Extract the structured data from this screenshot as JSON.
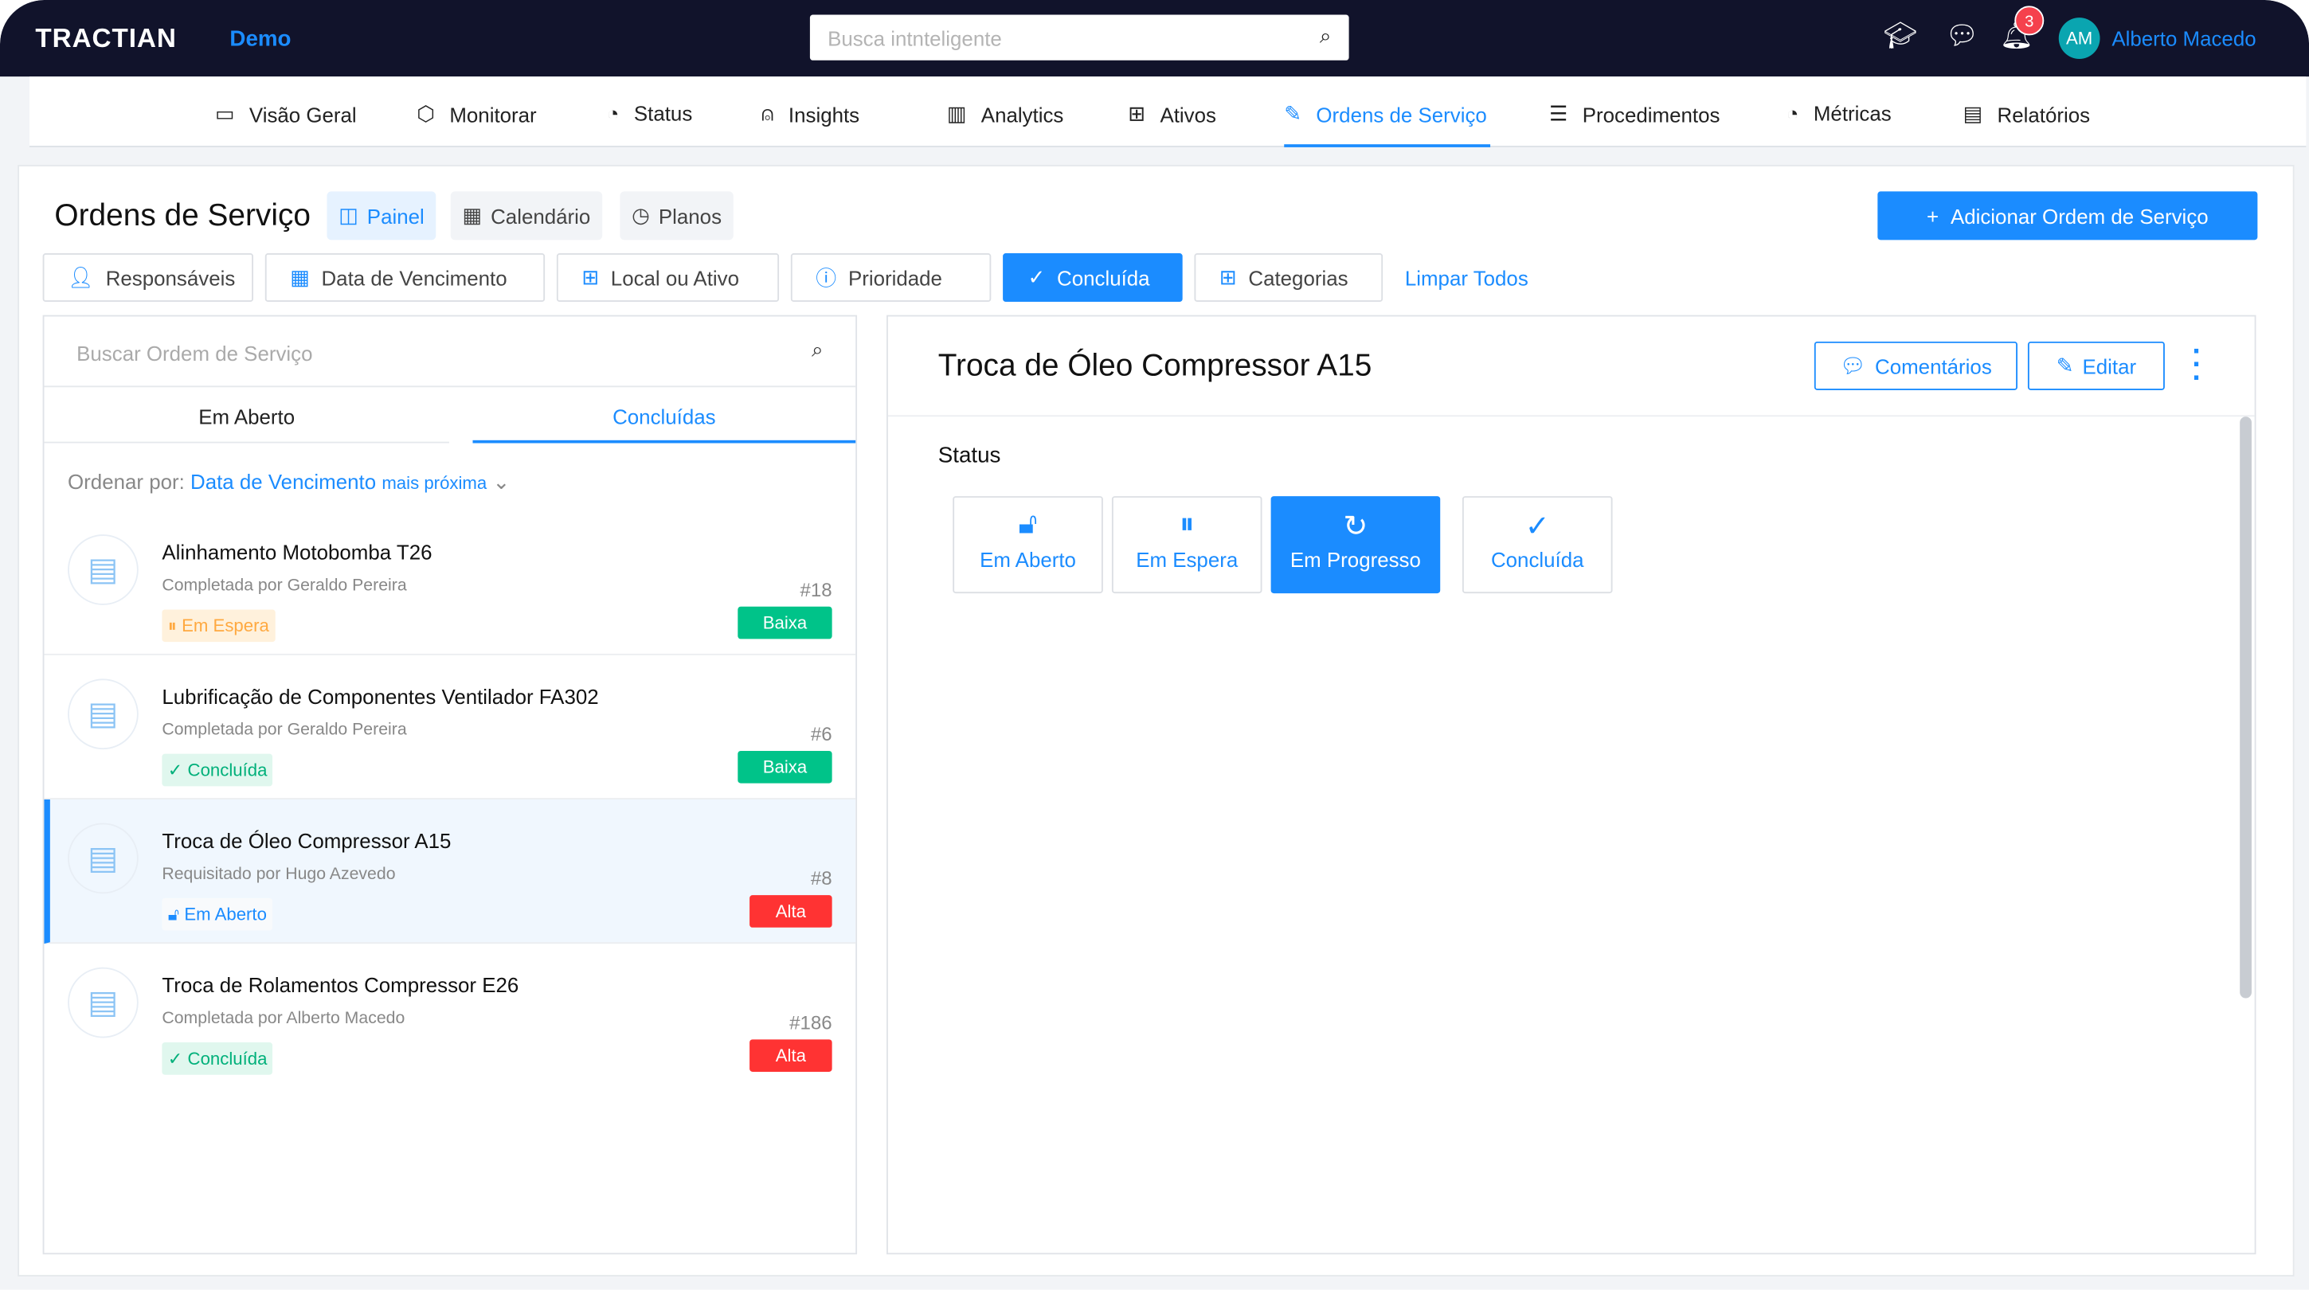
{
  "header": {
    "logo": "TRACTIAN",
    "workspace": "Demo",
    "search_placeholder": "Busca intnteligente",
    "notifications": "3",
    "avatar_initials": "AM",
    "user_name": "Alberto Macedo"
  },
  "nav": [
    {
      "label": "Visão Geral",
      "icon": "monitor-icon"
    },
    {
      "label": "Monitorar",
      "icon": "cube-icon"
    },
    {
      "label": "Status",
      "icon": "gauge-icon"
    },
    {
      "label": "Insights",
      "icon": "alarm-icon"
    },
    {
      "label": "Analytics",
      "icon": "bar-chart-icon"
    },
    {
      "label": "Ativos",
      "icon": "hierarchy-icon"
    },
    {
      "label": "Ordens de Serviço",
      "icon": "edit-icon",
      "active": true
    },
    {
      "label": "Procedimentos",
      "icon": "list-icon"
    },
    {
      "label": "Métricas",
      "icon": "gauge-icon"
    },
    {
      "label": "Relatórios",
      "icon": "report-icon"
    }
  ],
  "page": {
    "title": "Ordens de Serviço",
    "views": [
      "Painel",
      "Calendário",
      "Planos"
    ],
    "add_button": "Adicionar Ordem de Serviço",
    "filters": [
      "Responsáveis",
      "Data de Vencimento",
      "Local ou Ativo",
      "Prioridade",
      "Concluída",
      "Categorias"
    ],
    "clear_all": "Limpar Todos"
  },
  "list": {
    "search_placeholder": "Buscar Ordem de Serviço",
    "tabs": [
      "Em Aberto",
      "Concluídas"
    ],
    "sort_label": "Ordenar por:",
    "sort_field": "Data de Vencimento",
    "sort_dir": "mais próxima",
    "items": [
      {
        "title": "Alinhamento Motobomba T26",
        "by": "Completada por Geraldo Pereira",
        "number": "#18",
        "status": "Em Espera",
        "priority": "Baixa"
      },
      {
        "title": "Lubrificação de Componentes Ventilador FA302",
        "by": "Completada por Geraldo Pereira",
        "number": "#6",
        "status": "Concluída",
        "priority": "Baixa"
      },
      {
        "title": "Troca de Óleo Compressor A15",
        "by": "Requisitado por Hugo Azevedo",
        "number": "#8",
        "status": "Em Aberto",
        "priority": "Alta"
      },
      {
        "title": "Troca de Rolamentos Compressor E26",
        "by": "Completada por Alberto Macedo",
        "number": "#186",
        "status": "Concluída",
        "priority": "Alta"
      }
    ]
  },
  "detail": {
    "title": "Troca de Óleo Compressor A15",
    "comments": "Comentários",
    "edit": "Editar",
    "status_label": "Status",
    "statuses": [
      "Em Aberto",
      "Em Espera",
      "Em Progresso",
      "Concluída"
    ],
    "current_status": "Em Progresso"
  },
  "colors": {
    "brand": "#1b8cff",
    "header_bg": "#11132b",
    "low": "#00c389",
    "high": "#ff3333",
    "waiting": "#ffa940"
  }
}
